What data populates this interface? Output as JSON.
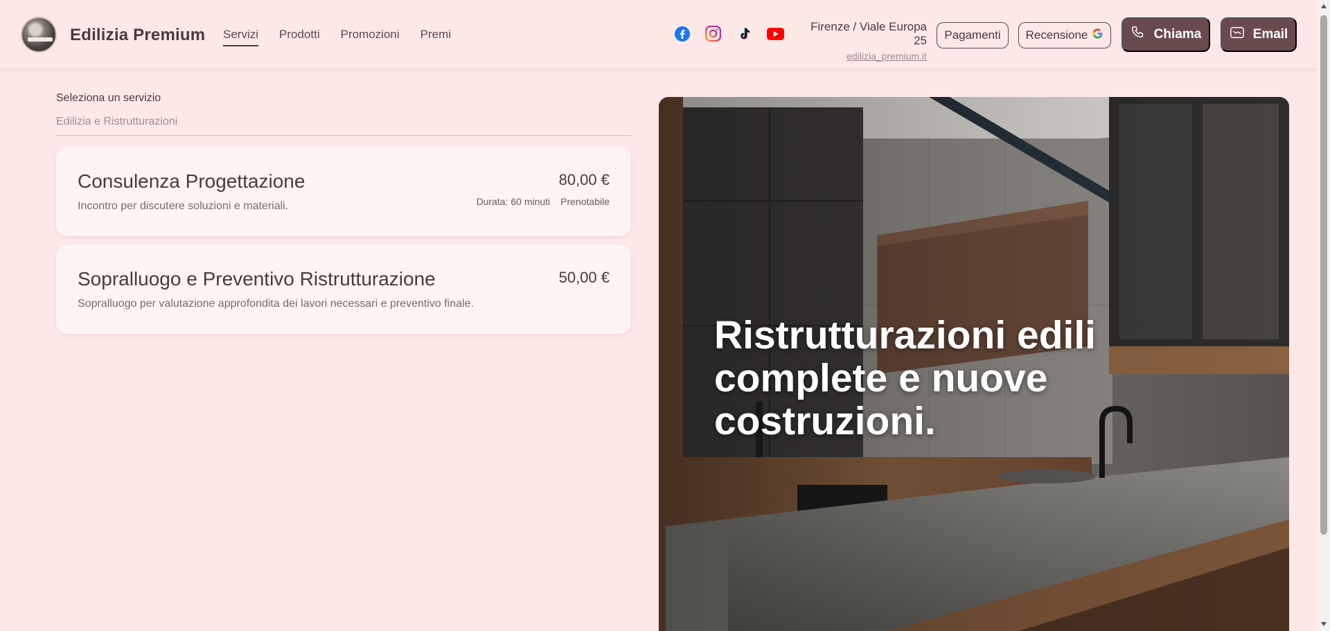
{
  "header": {
    "brand": "Edilizia Premium",
    "nav": [
      {
        "label": "Servizi",
        "active": true
      },
      {
        "label": "Prodotti",
        "active": false
      },
      {
        "label": "Promozioni",
        "active": false
      },
      {
        "label": "Premi",
        "active": false
      }
    ],
    "social_icons": [
      "facebook-icon",
      "instagram-icon",
      "tiktok-icon",
      "youtube-icon"
    ],
    "address": "Firenze / Viale Europa 25",
    "website": "edilizia_premium.it",
    "pagamenti_label": "Pagamenti",
    "recensione_label": "Recensione",
    "chiama_label": "Chiama",
    "email_label": "Email"
  },
  "service_select": {
    "label": "Seleziona un servizio",
    "value": "Edilizia e Ristrutturazioni"
  },
  "services": [
    {
      "title": "Consulenza Progettazione",
      "description": "Incontro per discutere soluzioni e materiali.",
      "price": "80,00 €",
      "duration": "Durata: 60 minuti",
      "status": "Prenotabile"
    },
    {
      "title": "Sopralluogo e Preventivo Ristrutturazione",
      "description": "Sopralluogo per valutazione approfondita dei lavori necessari e preventivo finale.",
      "price": "50,00 €"
    }
  ],
  "hero": {
    "headline": "Ristrutturazioni edili complete e nuove costruzioni."
  },
  "colors": {
    "background": "#fde8e8",
    "accent": "#6b4a4e",
    "text": "#4a3a3a",
    "card": "#fff4f4"
  }
}
